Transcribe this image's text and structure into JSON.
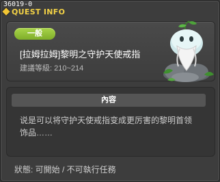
{
  "window": {
    "quest_id": "36019-0",
    "title": "QUEST INFO"
  },
  "quest": {
    "category_badge": "一般",
    "name": "[拉姆拉姆]黎明之守护天使戒指",
    "level_range": "建議等級: 210~214",
    "npc_icon": "spirit-npc-icon"
  },
  "description": {
    "header": "內容",
    "text": "说是可以将守护天使戒指变成更厉害的黎明首领饰品……"
  },
  "status": {
    "text": "狀態: 可開始 / 不可執行任務"
  },
  "colors": {
    "title_text": "#f3d246",
    "badge": "#8dbc34",
    "window_bg": "#3d3d3d"
  }
}
